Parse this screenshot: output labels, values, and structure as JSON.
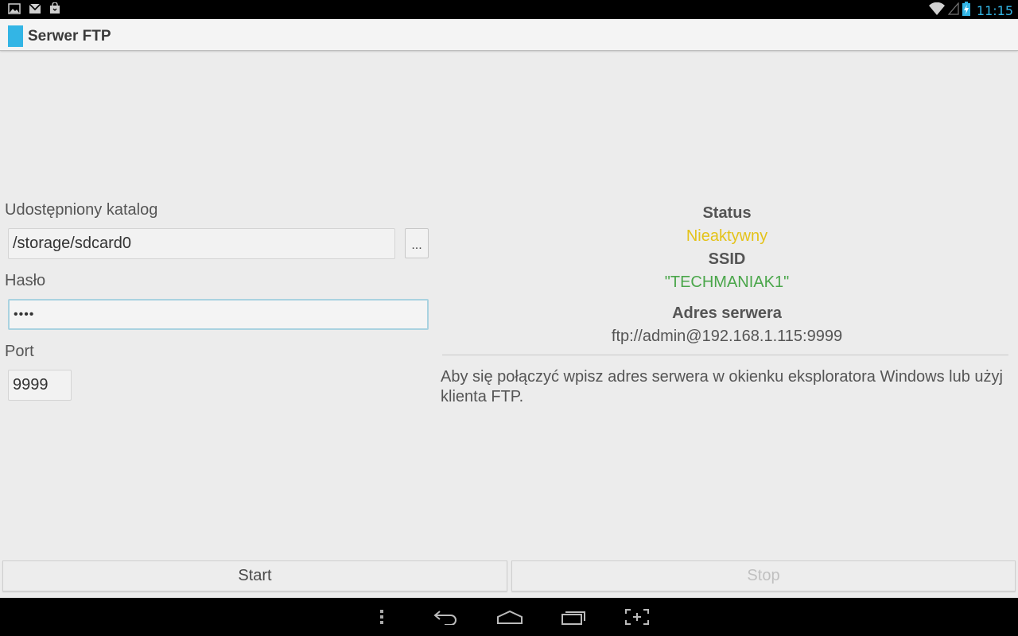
{
  "status_bar": {
    "time": "11:15",
    "left_icons": [
      "gallery-icon",
      "gmail-icon",
      "shop-bag-icon"
    ],
    "right_icons": [
      "wifi-icon",
      "signal-icon",
      "battery-charging-icon"
    ]
  },
  "action_bar": {
    "title": "Serwer FTP"
  },
  "form": {
    "directory_label": "Udostępniony katalog",
    "directory_value": "/storage/sdcard0",
    "browse_label": "...",
    "password_label": "Hasło",
    "password_value": "••••",
    "port_label": "Port",
    "port_value": "9999"
  },
  "info": {
    "status_label": "Status",
    "status_value": "Nieaktywny",
    "ssid_label": "SSID",
    "ssid_value": "\"TECHMANIAK1\"",
    "address_label": "Adres serwera",
    "address_value": "ftp://admin@192.168.1.115:9999",
    "hint": "Aby się połączyć wpisz adres serwera w okienku eksploratora Windows lub użyj klienta FTP."
  },
  "buttons": {
    "start": "Start",
    "stop": "Stop"
  },
  "nav_bar": {
    "icons": [
      "menu-dots-icon",
      "back-icon",
      "home-icon",
      "recents-icon",
      "screenshot-icon"
    ]
  },
  "colors": {
    "accent": "#33b5e5",
    "status_inactive": "#e4c31a",
    "ssid": "#4aa64a"
  }
}
